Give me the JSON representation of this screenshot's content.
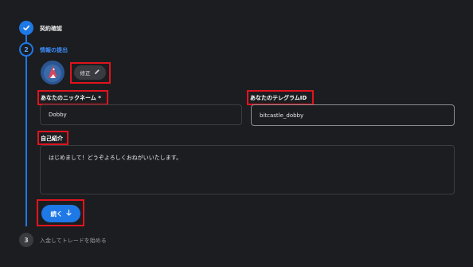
{
  "stepper": {
    "steps": [
      {
        "label": "契約確認",
        "status": "done"
      },
      {
        "label": "情報の提出",
        "number": "2",
        "status": "active"
      },
      {
        "label": "入金してトレードを始める",
        "number": "3",
        "status": "pending"
      }
    ]
  },
  "profile": {
    "edit_label": "修正"
  },
  "form": {
    "nickname_label": "あなたのニックネーム *",
    "nickname_value": "Dobby",
    "telegram_label": "あなたのテレグラムID",
    "telegram_value": "bitcastle_dobby",
    "intro_label": "自己紹介",
    "intro_value": "はじめまして！どうぞよろしくおねがいいたします。"
  },
  "actions": {
    "next_label": "続く"
  },
  "colors": {
    "accent": "#1e78e6",
    "highlight": "#e0141e",
    "background": "#1c1d20"
  }
}
